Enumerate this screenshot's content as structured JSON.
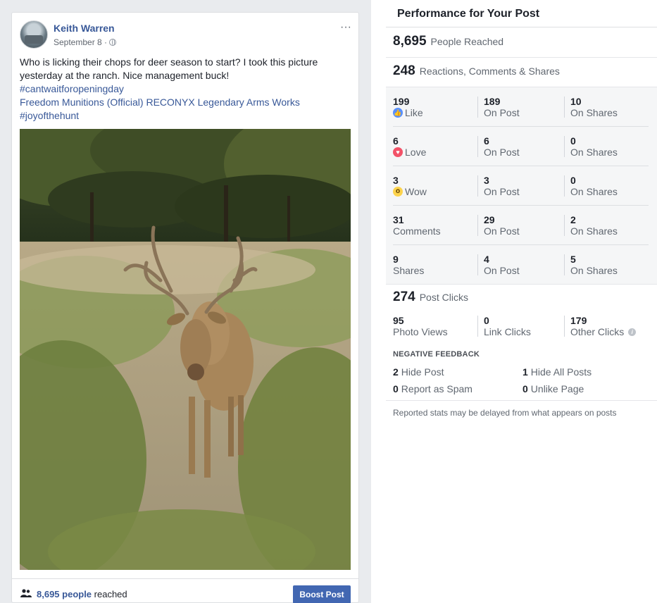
{
  "post": {
    "author": "Keith Warren",
    "date": "September 8 ·",
    "more": "···",
    "text_line1": "Who is licking their chops for deer season to start? I took this picture yesterday at the ranch. Nice management buck!",
    "hashtag1": "#cantwaitforopeningday",
    "mentions": "Freedom Munitions (Official) RECONYX Legendary Arms Works",
    "hashtag2": "#joyofthehunt",
    "footer": {
      "reach_num": "8,695 people",
      "reach_suffix": " reached",
      "boost_label": "Boost Post"
    }
  },
  "panel": {
    "title": "Performance for Your Post",
    "people_reached": {
      "num": "8,695",
      "label": "People Reached"
    },
    "engagement": {
      "num": "248",
      "label": "Reactions, Comments & Shares"
    },
    "breakdown": [
      {
        "total": "199",
        "label": "Like",
        "icon": "like-icon",
        "on_post": "189",
        "on_post_label": "On Post",
        "on_shares": "10",
        "on_shares_label": "On Shares"
      },
      {
        "total": "6",
        "label": "Love",
        "icon": "love-icon",
        "on_post": "6",
        "on_post_label": "On Post",
        "on_shares": "0",
        "on_shares_label": "On Shares"
      },
      {
        "total": "3",
        "label": "Wow",
        "icon": "wow-icon",
        "on_post": "3",
        "on_post_label": "On Post",
        "on_shares": "0",
        "on_shares_label": "On Shares"
      },
      {
        "total": "31",
        "label": "Comments",
        "icon": "",
        "on_post": "29",
        "on_post_label": "On Post",
        "on_shares": "2",
        "on_shares_label": "On Shares"
      },
      {
        "total": "9",
        "label": "Shares",
        "icon": "",
        "on_post": "4",
        "on_post_label": "On Post",
        "on_shares": "5",
        "on_shares_label": "On Shares"
      }
    ],
    "post_clicks": {
      "num": "274",
      "label": "Post Clicks"
    },
    "clicks": [
      {
        "num": "95",
        "label": "Photo Views"
      },
      {
        "num": "0",
        "label": "Link Clicks"
      },
      {
        "num": "179",
        "label": "Other Clicks"
      }
    ],
    "negative": {
      "title": "NEGATIVE FEEDBACK",
      "hide_post": {
        "num": "2",
        "label": "Hide Post"
      },
      "hide_all": {
        "num": "1",
        "label": "Hide All Posts"
      },
      "report_spam": {
        "num": "0",
        "label": "Report as Spam"
      },
      "unlike_page": {
        "num": "0",
        "label": "Unlike Page"
      }
    },
    "footnote": "Reported stats may be delayed from what appears on posts"
  },
  "colors": {
    "link_blue": "#385898",
    "boost_blue": "#4267b2",
    "background": "#e9ebee"
  }
}
